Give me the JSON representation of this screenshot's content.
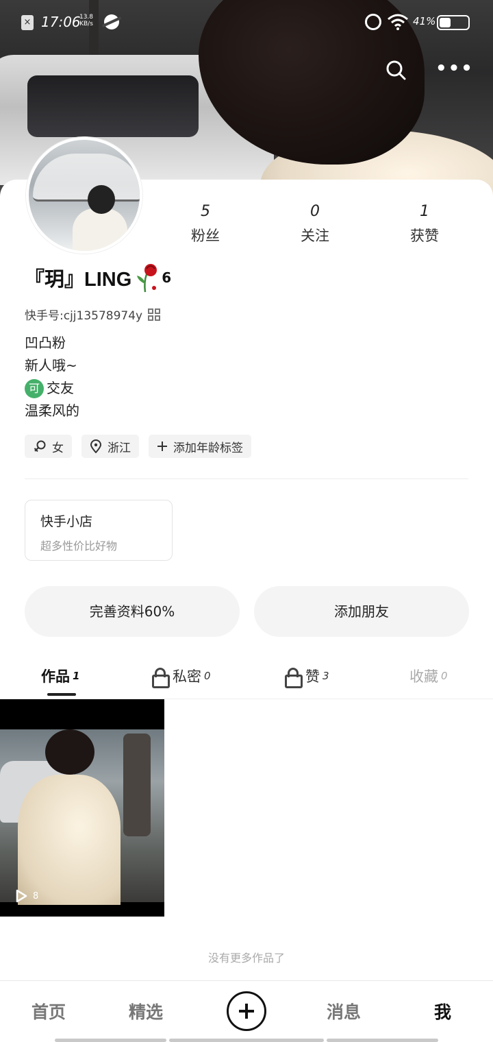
{
  "status_bar": {
    "time": "17:06",
    "net_speed_value": "13.8",
    "net_speed_unit": "KB/s",
    "battery_percent": "41%",
    "battery_level": 0.41
  },
  "profile": {
    "stats": [
      {
        "value": "5",
        "label": "粉丝"
      },
      {
        "value": "0",
        "label": "关注"
      },
      {
        "value": "1",
        "label": "获赞"
      }
    ],
    "nickname": "『玥』LING",
    "nickname_suffix": "6",
    "kuaishou_id": "快手号:cjj13578974y",
    "bio": {
      "line1": "凹凸粉",
      "line2": "新人哦~",
      "line3_badge": "可",
      "line3_text": "交友",
      "line4": "温柔风的"
    },
    "tags": [
      {
        "icon": "gender-female-icon",
        "label": "女"
      },
      {
        "icon": "location-icon",
        "label": "浙江"
      },
      {
        "icon": "plus-icon",
        "label": "添加年龄标签"
      }
    ]
  },
  "shop": {
    "title": "快手小店",
    "subtitle": "超多性价比好物"
  },
  "actions": {
    "complete_profile": "完善资料60%",
    "add_friends": "添加朋友"
  },
  "tabs": [
    {
      "label": "作品",
      "count": "1"
    },
    {
      "label": "私密",
      "count": "0"
    },
    {
      "label": "赞",
      "count": "3"
    },
    {
      "label": "收藏",
      "count": "0"
    }
  ],
  "posts": [
    {
      "play_count": "8"
    }
  ],
  "no_more_text": "没有更多作品了",
  "bottom_nav": {
    "home": "首页",
    "featured": "精选",
    "messages": "消息",
    "me": "我"
  }
}
